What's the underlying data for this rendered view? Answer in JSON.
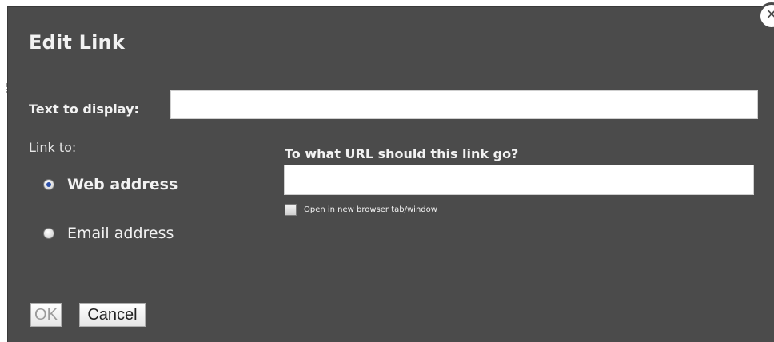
{
  "dialog": {
    "title": "Edit Link",
    "close_icon": "close-icon"
  },
  "display_text": {
    "label": "Text to display:",
    "value": ""
  },
  "link_to": {
    "label": "Link to:",
    "options": [
      {
        "label": "Web address",
        "selected": true
      },
      {
        "label": "Email address",
        "selected": false
      }
    ]
  },
  "url": {
    "question": "To what URL should this link go?",
    "value": "",
    "new_tab_label": "Open in new browser tab/window",
    "new_tab_checked": false
  },
  "buttons": {
    "ok": "OK",
    "cancel": "Cancel"
  },
  "colors": {
    "dialog_bg": "#4b4b4b",
    "text": "#f2f2f2",
    "radio_selected": "#2b4fa8"
  }
}
